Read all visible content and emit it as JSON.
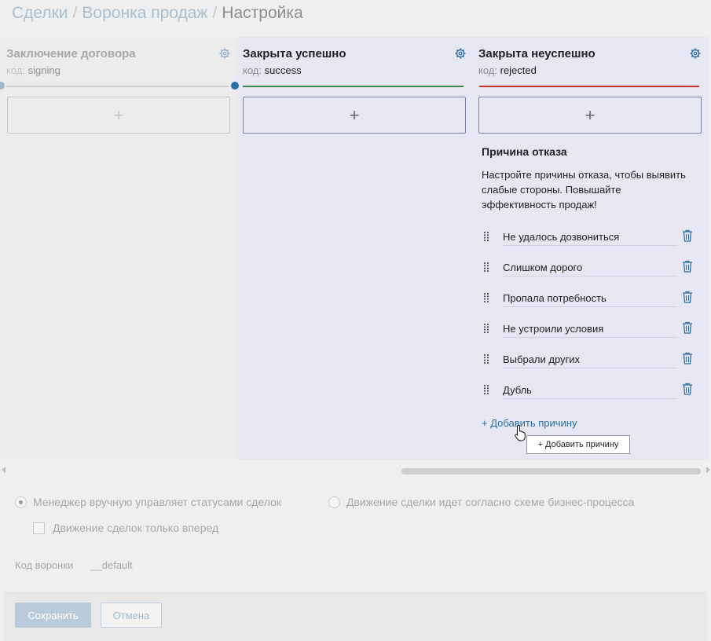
{
  "breadcrumb": {
    "item1": "Сделки",
    "item2": "Воронка продаж",
    "current": "Настройка",
    "separator": "/"
  },
  "colors": {
    "accent": "#2c6ea3",
    "success_line": "#3a8a4e",
    "rejected_line": "#c9302c"
  },
  "columns": [
    {
      "title": "Заключение договора",
      "code_key": "код:",
      "code_value": "signing",
      "add": "+"
    },
    {
      "title": "Закрыта успешно",
      "code_key": "код:",
      "code_value": "success",
      "add": "+"
    },
    {
      "title": "Закрыта неуспешно",
      "code_key": "код:",
      "code_value": "rejected",
      "add": "+"
    }
  ],
  "reasons": {
    "title": "Причина отказа",
    "description": "Настройте причины отказа, чтобы выявить слабые стороны. Повышайте эффективность продаж!",
    "items": [
      "Не удалось дозвониться",
      "Слишком дорого",
      "Пропала потребность",
      "Не устроили условия",
      "Выбрали других",
      "Дубль"
    ],
    "add_label": "+ Добавить причину",
    "tooltip": "+ Добавить причину"
  },
  "settings": {
    "radio_manual": "Менеджер вручную управляет статусами сделок",
    "radio_process": "Движение сделки идет согласно схеме бизнес-процесса",
    "checkbox_forward": "Движение сделок только вперед",
    "code_label": "Код воронки",
    "code_value": "__default"
  },
  "footer": {
    "save": "Сохранить",
    "cancel": "Отмена"
  }
}
